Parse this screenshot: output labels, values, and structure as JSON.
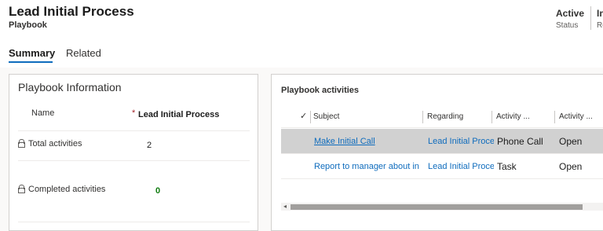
{
  "record": {
    "title": "Lead Initial Process",
    "entity": "Playbook",
    "status_value": "Active",
    "status_label": "Status",
    "next_value": "In",
    "next_label": "Re"
  },
  "tabs": [
    {
      "label": "Summary",
      "active": true
    },
    {
      "label": "Related",
      "active": false
    }
  ],
  "playbook_info": {
    "title": "Playbook Information",
    "name_label": "Name",
    "required_mark": "*",
    "name_value": "Lead Initial Process",
    "total_label": "Total activities",
    "total_value": "2",
    "completed_label": "Completed activities",
    "completed_value": "0"
  },
  "activities": {
    "title": "Playbook activities",
    "check_glyph": "✓",
    "columns": [
      "Subject",
      "Regarding",
      "Activity ...",
      "Activity ..."
    ],
    "rows": [
      {
        "subject": "Make Initial Call",
        "regarding": "Lead Initial Proce",
        "type": "Phone Call",
        "state": "Open",
        "selected": true
      },
      {
        "subject": "Report to manager about in",
        "regarding": "Lead Initial Proce",
        "type": "Task",
        "state": "Open",
        "selected": false
      }
    ],
    "scroll_left_glyph": "◂"
  }
}
